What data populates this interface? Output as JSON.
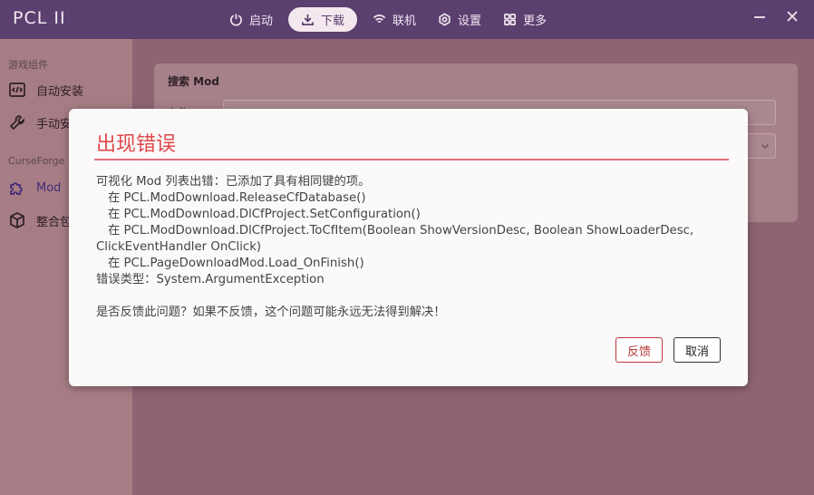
{
  "app": {
    "logo": "PCL II"
  },
  "nav": {
    "items": [
      {
        "label": "启动",
        "icon": "power-icon"
      },
      {
        "label": "下载",
        "icon": "download-icon",
        "active": true
      },
      {
        "label": "联机",
        "icon": "wifi-icon"
      },
      {
        "label": "设置",
        "icon": "gear-icon"
      },
      {
        "label": "更多",
        "icon": "grid-icon"
      }
    ]
  },
  "sidebar": {
    "section_game": "游戏组件",
    "item_auto": "自动安装",
    "item_manual": "手动安装",
    "section_curseforge": "CurseForge",
    "item_mod": "Mod",
    "item_modpack": "整合包"
  },
  "card": {
    "title": "搜索 Mod",
    "label": "名称"
  },
  "dialog": {
    "title": "出现错误",
    "lines": [
      "可视化 Mod 列表出错：已添加了具有相同键的项。",
      "在 PCL.ModDownload.ReleaseCfDatabase()",
      "在 PCL.ModDownload.DlCfProject.SetConfiguration()",
      "在 PCL.ModDownload.DlCfProject.ToCfItem(Boolean ShowVersionDesc, Boolean ShowLoaderDesc,",
      "ClickEventHandler OnClick)",
      "在 PCL.PageDownloadMod.Load_OnFinish()",
      "错误类型：System.ArgumentException"
    ],
    "question": "是否反馈此问题？如果不反馈，这个问题可能永远无法得到解决！",
    "feedback_label": "反馈",
    "cancel_label": "取消"
  },
  "colors": {
    "titlebar": "#5a3f6f",
    "accent_error": "#e0484b",
    "feedback_border": "#b73a3a"
  }
}
